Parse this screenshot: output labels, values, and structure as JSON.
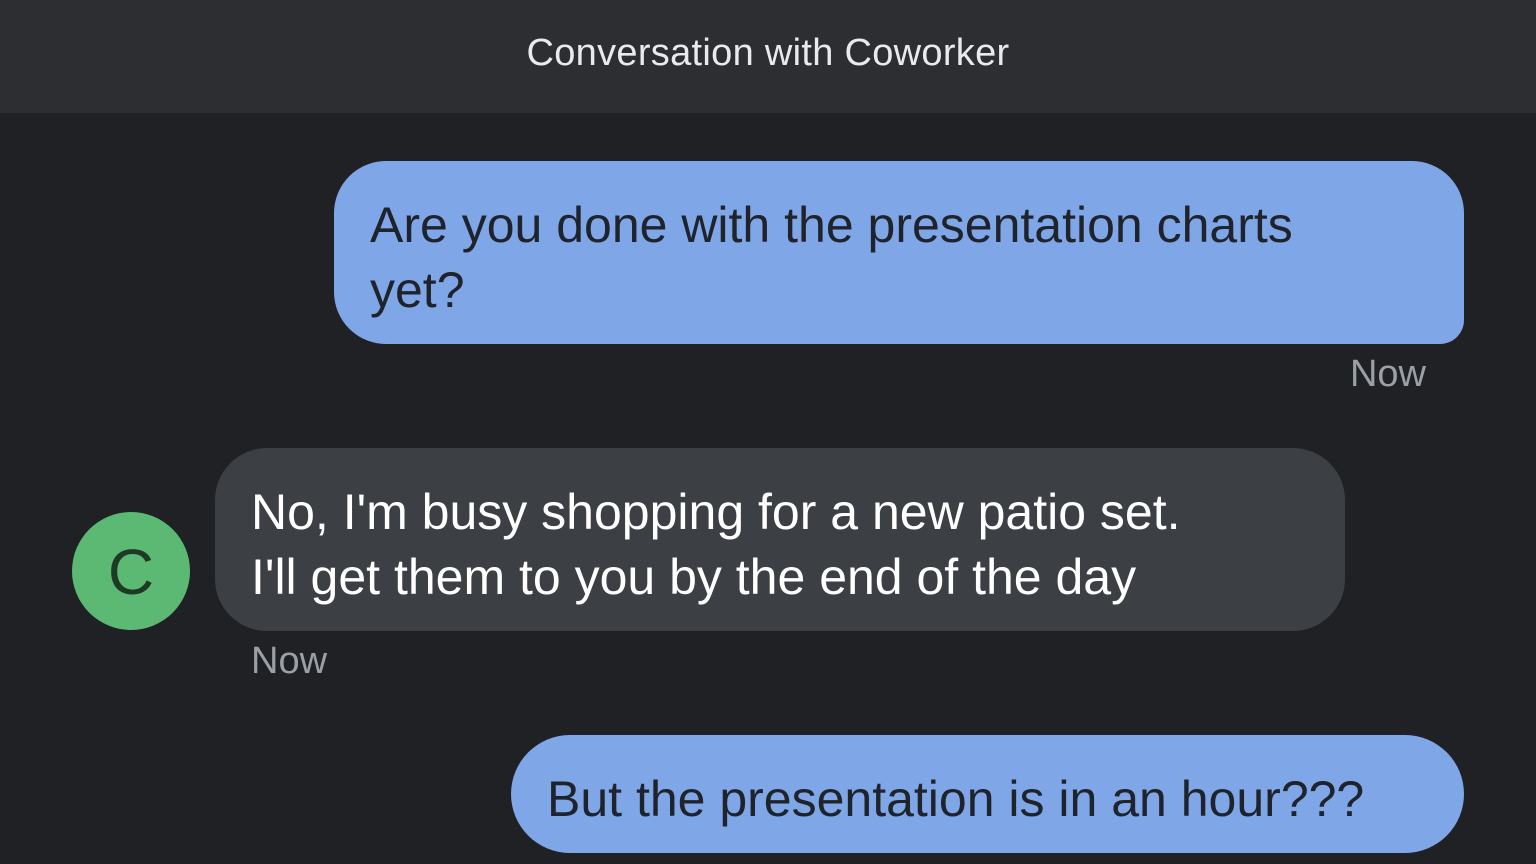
{
  "header": {
    "title": "Conversation with Coworker"
  },
  "contact": {
    "avatar_initial": "C",
    "avatar_color": "#5bb974"
  },
  "messages": [
    {
      "direction": "outgoing",
      "lines": [
        "Are you done with the presentation charts",
        "yet?"
      ],
      "timestamp": "Now"
    },
    {
      "direction": "incoming",
      "lines": [
        "No, I'm busy shopping for a new patio set.",
        "I'll get them to you by the end of the day"
      ],
      "timestamp": "Now"
    },
    {
      "direction": "outgoing",
      "lines": [
        "But the presentation is in an hour???"
      ]
    }
  ],
  "colors": {
    "background": "#202124",
    "header_background": "#2d2e31",
    "outgoing_bubble": "#7fa6e6",
    "incoming_bubble": "#3c3f43",
    "timestamp_text": "#9aa0a6"
  }
}
